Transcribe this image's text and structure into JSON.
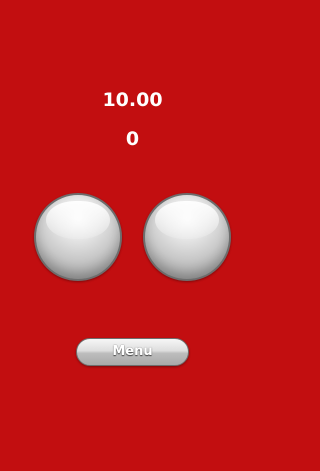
{
  "game": {
    "timer": "10.00",
    "score": "0",
    "menu_label": "Menu"
  },
  "colors": {
    "background": "#c20e10",
    "text": "#ffffff",
    "button_silver": "#c9c9c9"
  },
  "icons": {
    "left_button": "glossy-round-button-icon",
    "right_button": "glossy-round-button-icon"
  }
}
